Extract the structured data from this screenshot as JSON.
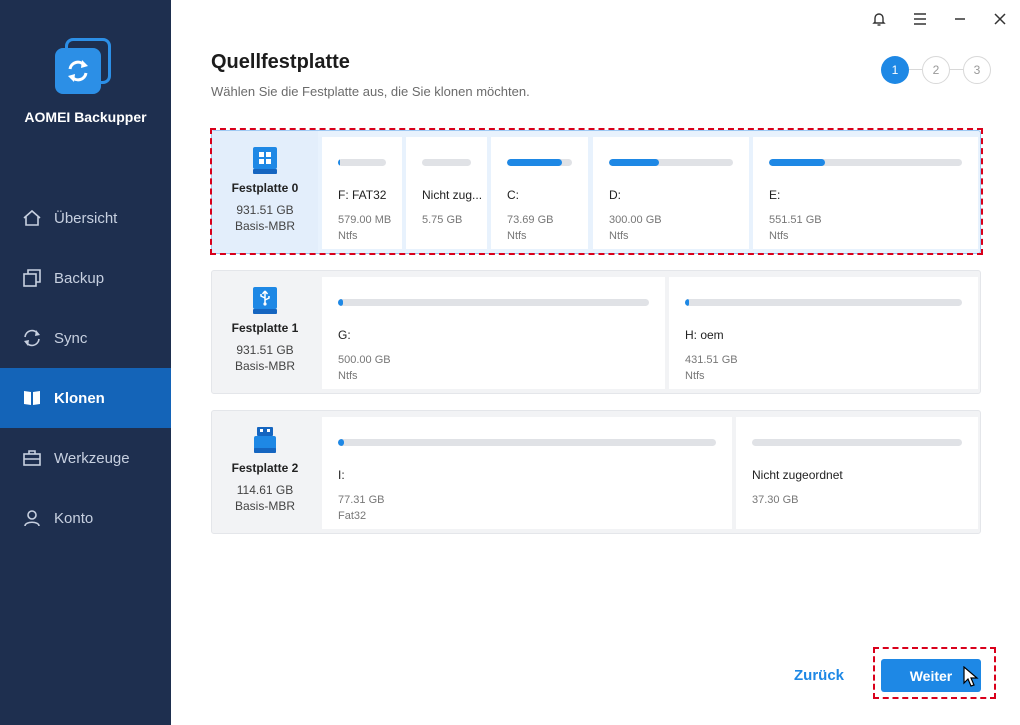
{
  "app": {
    "name": "AOMEI Backupper"
  },
  "sidebar": {
    "items": [
      {
        "label": "Übersicht",
        "icon": "home-icon"
      },
      {
        "label": "Backup",
        "icon": "backup-icon"
      },
      {
        "label": "Sync",
        "icon": "sync-icon"
      },
      {
        "label": "Klonen",
        "icon": "clone-icon",
        "active": true
      },
      {
        "label": "Werkzeuge",
        "icon": "toolbox-icon"
      },
      {
        "label": "Konto",
        "icon": "user-icon"
      }
    ]
  },
  "header": {
    "title": "Quellfestplatte",
    "subtitle": "Wählen Sie die Festplatte aus, die Sie klonen möchten."
  },
  "steps": {
    "current": "1",
    "step2": "2",
    "step3": "3"
  },
  "disks": [
    {
      "name": "Festplatte 0",
      "size": "931.51 GB",
      "type": "Basis-MBR",
      "icon": "windows-disk-icon",
      "selected": true,
      "partitions": [
        {
          "name": "F: FAT32",
          "size": "579.00 MB",
          "fs": "Ntfs",
          "used": 0.04
        },
        {
          "name": "Nicht zug...",
          "size": "5.75 GB",
          "fs": "",
          "used": 0
        },
        {
          "name": "C:",
          "size": "73.69 GB",
          "fs": "Ntfs",
          "used": 0.85
        },
        {
          "name": "D:",
          "size": "300.00 GB",
          "fs": "Ntfs",
          "used": 0.4
        },
        {
          "name": "E:",
          "size": "551.51 GB",
          "fs": "Ntfs",
          "used": 0.29
        }
      ]
    },
    {
      "name": "Festplatte 1",
      "size": "931.51 GB",
      "type": "Basis-MBR",
      "icon": "usb-disk-icon",
      "selected": false,
      "partitions": [
        {
          "name": "G:",
          "size": "500.00 GB",
          "fs": "Ntfs",
          "used": 0.01
        },
        {
          "name": "H: oem",
          "size": "431.51 GB",
          "fs": "Ntfs",
          "used": 0.01
        }
      ]
    },
    {
      "name": "Festplatte 2",
      "size": "114.61 GB",
      "type": "Basis-MBR",
      "icon": "usb-drive-icon",
      "selected": false,
      "partitions": [
        {
          "name": "I:",
          "size": "77.31 GB",
          "fs": "Fat32",
          "used": 0.01
        },
        {
          "name": "Nicht zugeordnet",
          "size": "37.30 GB",
          "fs": "",
          "used": 0
        }
      ]
    }
  ],
  "footer": {
    "back_label": "Zurück",
    "next_label": "Weiter"
  },
  "colors": {
    "sidebar": "#1e2f4f",
    "accent": "#1e88e5",
    "highlight": "#d9001b"
  }
}
